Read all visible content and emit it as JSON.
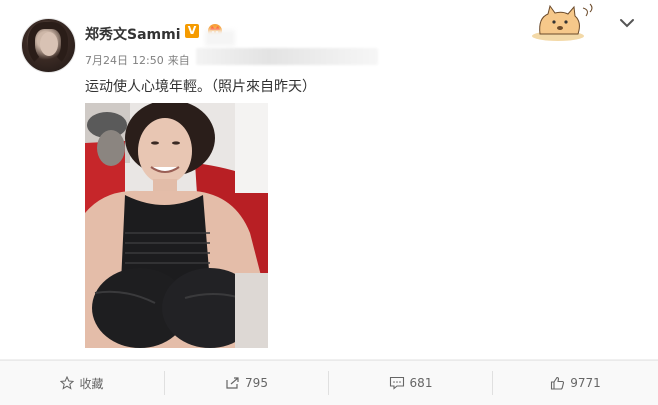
{
  "post": {
    "author": "郑秀文Sammi",
    "verified_badge": "V",
    "date": "7月24日",
    "time": "12:50",
    "source_prefix": "来自",
    "text": "运动使人心境年輕。（照片來自昨天）"
  },
  "actions": {
    "favorite": "收藏",
    "repost_count": "795",
    "comment_count": "681",
    "like_count": "9771"
  },
  "icons": {
    "favorite": "star-outline-icon",
    "repost": "share-arrow-icon",
    "comment": "comment-bubble-icon",
    "like": "thumbs-up-icon",
    "menu": "chevron-down-icon"
  },
  "colors": {
    "badge": "#f59b00",
    "text": "#333333",
    "meta": "#808080",
    "action_bar": "#f9f9f9"
  }
}
